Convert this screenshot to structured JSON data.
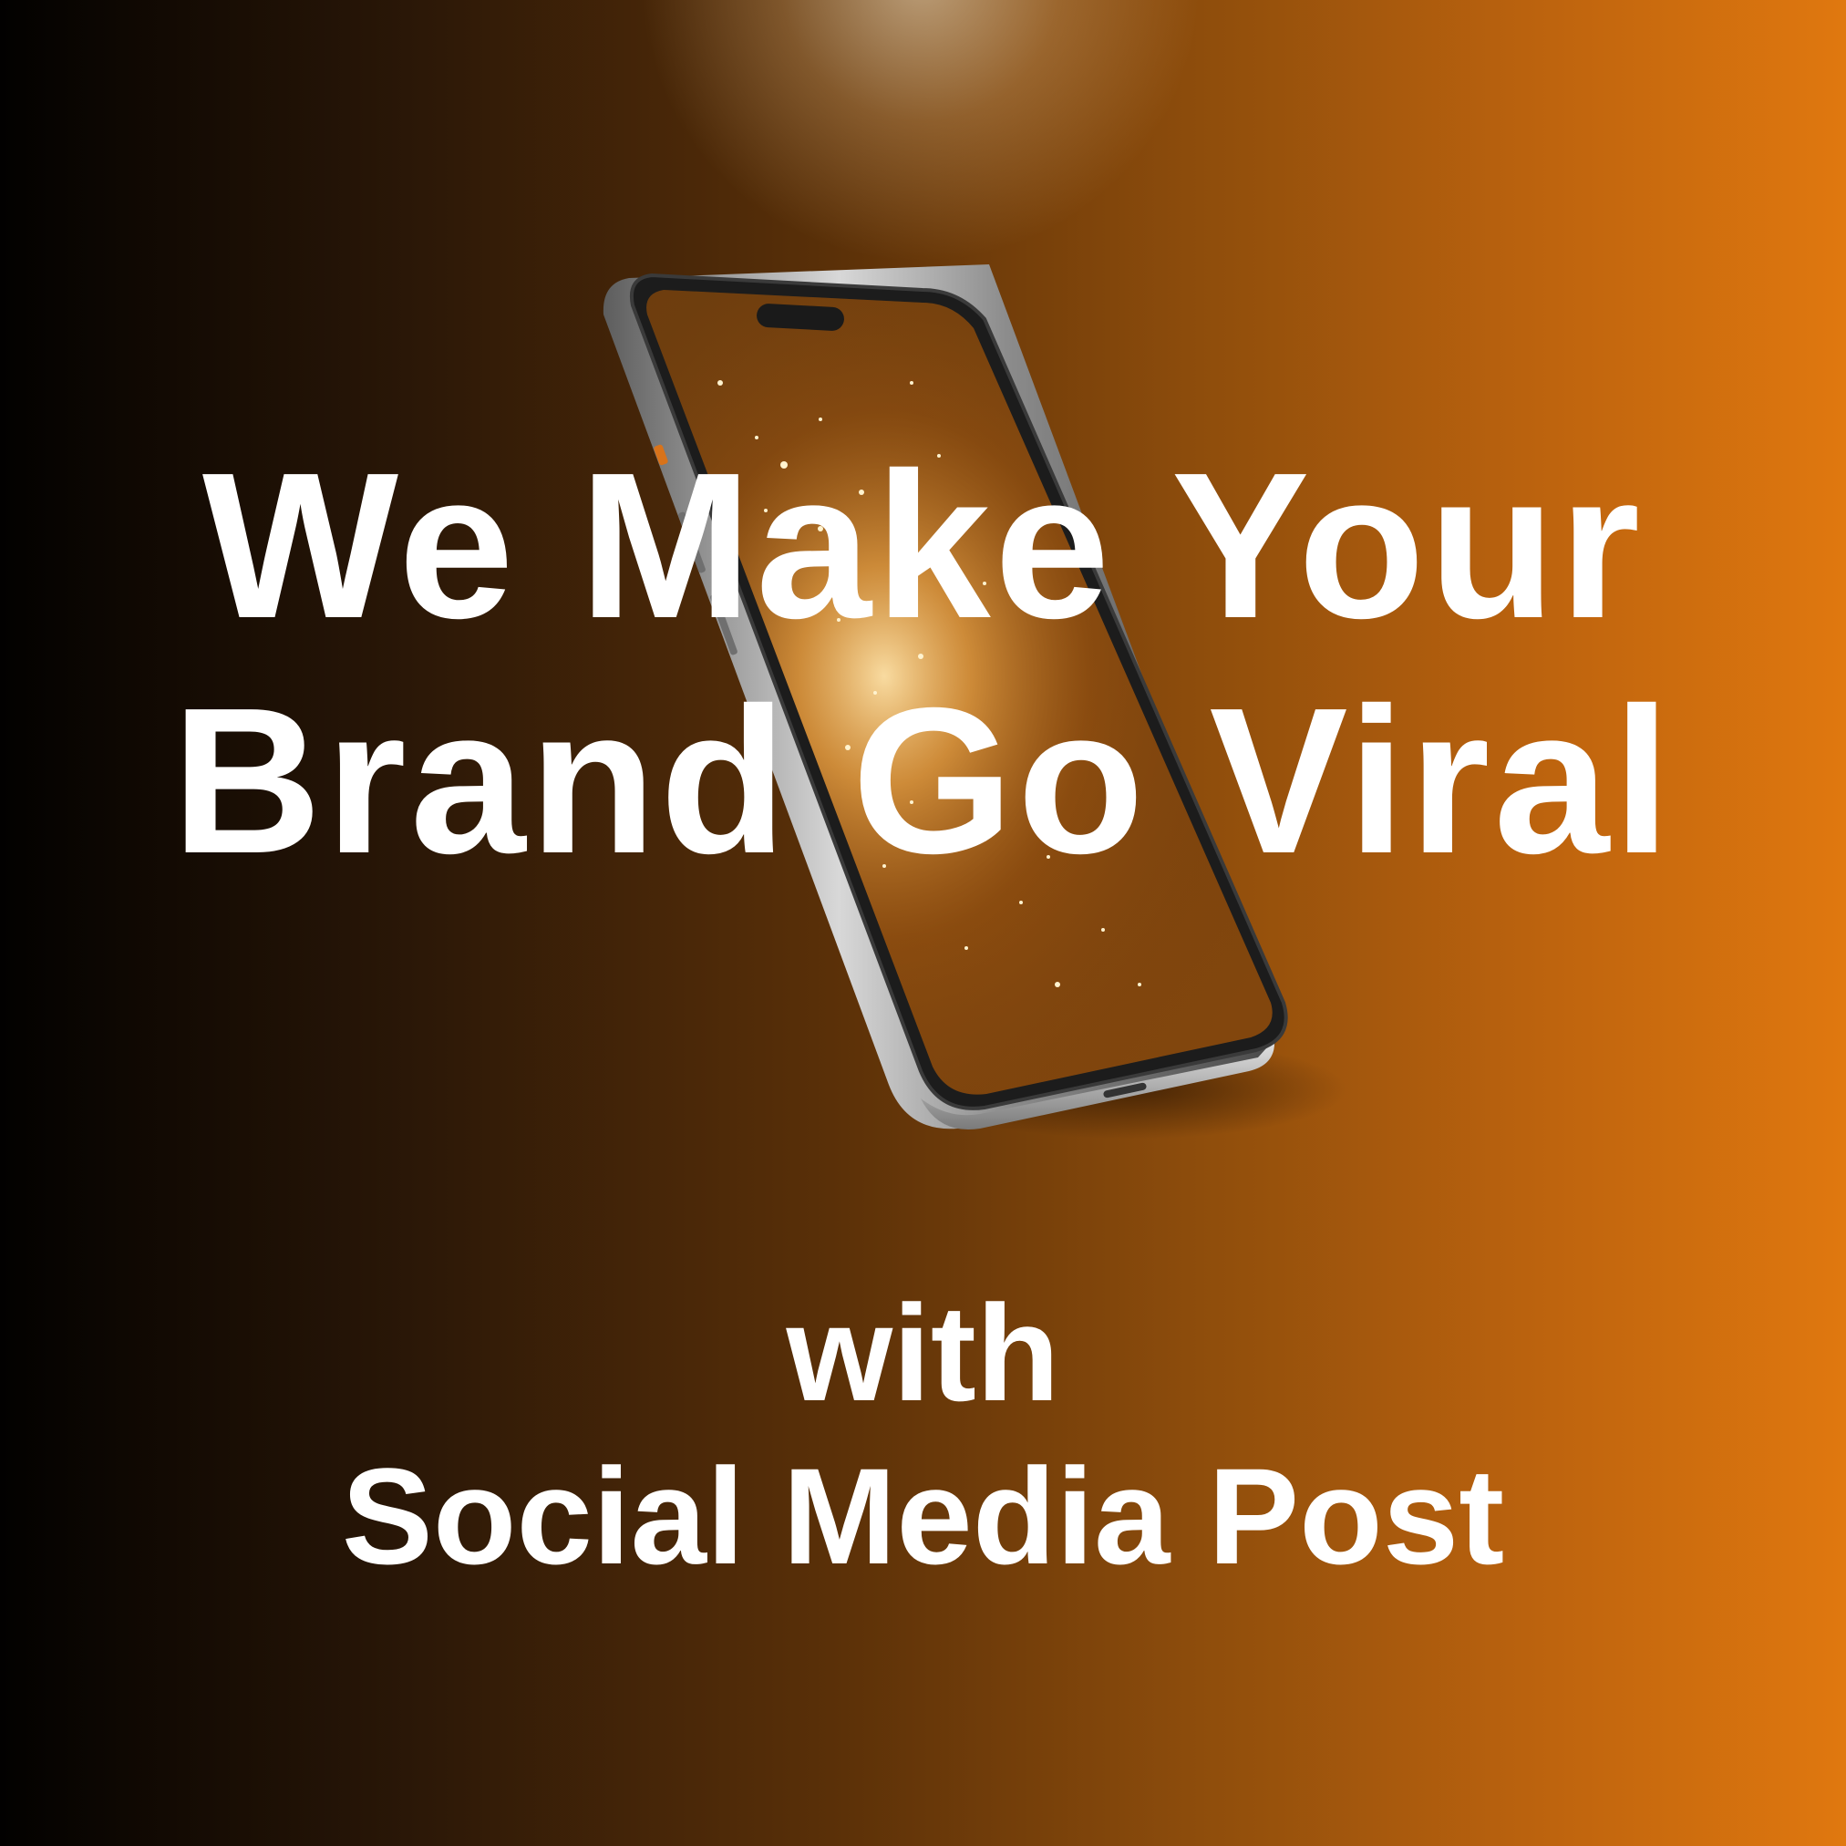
{
  "headline": {
    "line1": "We Make Your",
    "line2": "Brand Go Viral"
  },
  "subtitle": {
    "line1": "with",
    "line2": "Social Media Post"
  },
  "colors": {
    "background_left": "#020100",
    "background_right": "#e0780f",
    "text": "#ffffff",
    "phone_frame": "#9a9a9a",
    "screen_glow": "#ffd27a"
  },
  "illustration": {
    "icon": "smartphone-icon"
  }
}
